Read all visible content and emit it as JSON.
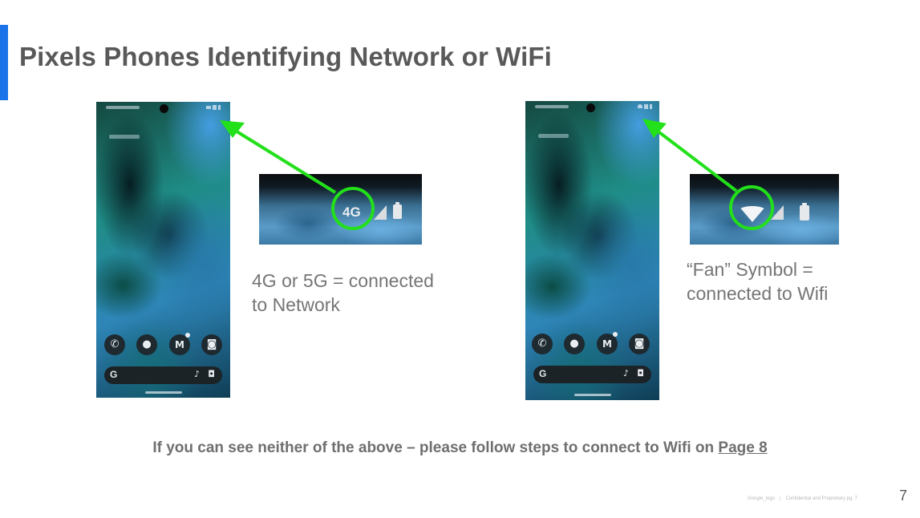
{
  "slide": {
    "title": "Pixels Phones Identifying Network or WiFi",
    "footer_text": "If you can see neither of the above – please follow steps to connect to Wifi on ",
    "footer_link": "Page 8",
    "logo_text": "Google_logo",
    "confidential_text": "Confidential and Proprietary  pg. 7",
    "page_number": "7"
  },
  "left_example": {
    "zoom_network_label": "4G",
    "caption_line1": "4G or 5G = connected",
    "caption_line2": "to Network"
  },
  "right_example": {
    "caption_line1": "“Fan” Symbol =",
    "caption_line2": "connected to Wifi"
  },
  "phone_icons": {
    "phone": "phone-icon",
    "messages": "messages-icon",
    "gmail": "gmail-icon",
    "camera": "camera-icon",
    "google_search": "google-g-icon",
    "mic": "mic-icon",
    "lens": "lens-icon"
  },
  "colors": {
    "accent_bar": "#1a73e8",
    "arrow_highlight": "#22e01a",
    "title_text": "#595959",
    "caption_text": "#757575"
  }
}
